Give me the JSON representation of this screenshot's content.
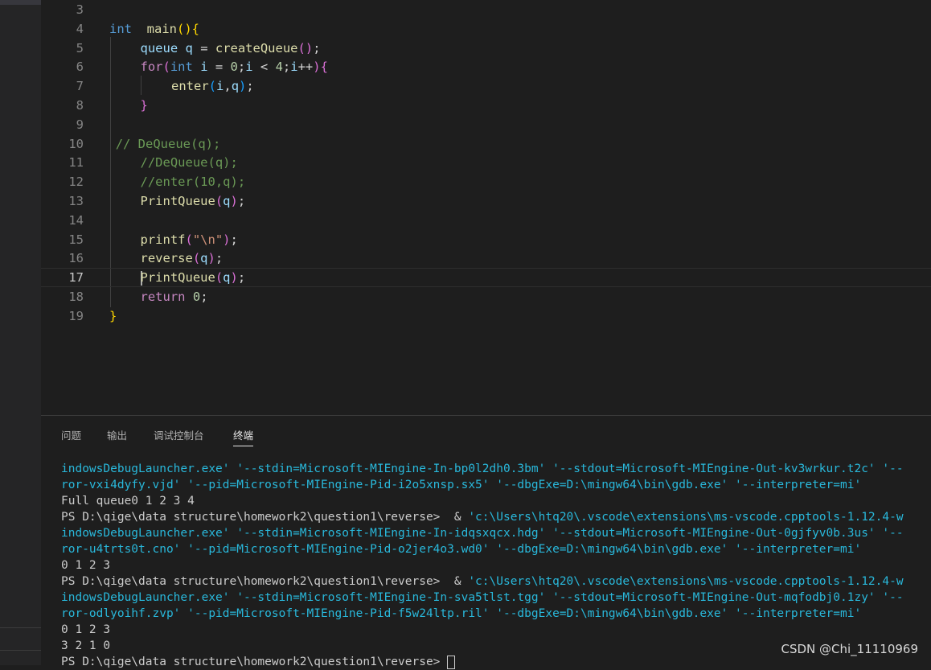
{
  "editor": {
    "lines": [
      {
        "n": "3"
      },
      {
        "n": "4",
        "parts": [
          [
            "kw",
            "int"
          ],
          [
            "",
            "  "
          ],
          [
            "fn",
            "main"
          ],
          [
            "br1",
            "()"
          ],
          [
            "br1",
            "{"
          ]
        ]
      },
      {
        "n": "5",
        "parts": [
          [
            "var",
            "queue"
          ],
          [
            "",
            " "
          ],
          [
            "var",
            "q"
          ],
          [
            "",
            " = "
          ],
          [
            "fn",
            "createQueue"
          ],
          [
            "br2",
            "()"
          ],
          [
            "",
            ";"
          ]
        ]
      },
      {
        "n": "6",
        "parts": [
          [
            "ctl",
            "for"
          ],
          [
            "br2",
            "("
          ],
          [
            "kw",
            "int"
          ],
          [
            "",
            " "
          ],
          [
            "var",
            "i"
          ],
          [
            "",
            " = "
          ],
          [
            "num",
            "0"
          ],
          [
            "",
            ";"
          ],
          [
            "var",
            "i"
          ],
          [
            "",
            " < "
          ],
          [
            "num",
            "4"
          ],
          [
            "",
            ";"
          ],
          [
            "var",
            "i"
          ],
          [
            "",
            "++"
          ],
          [
            "br2",
            ")"
          ],
          [
            "br2",
            "{"
          ]
        ]
      },
      {
        "n": "7",
        "parts": [
          [
            "fn",
            "enter"
          ],
          [
            "br3",
            "("
          ],
          [
            "var",
            "i"
          ],
          [
            "",
            ","
          ],
          [
            "var",
            "q"
          ],
          [
            "br3",
            ")"
          ],
          [
            "",
            ";"
          ]
        ]
      },
      {
        "n": "8",
        "parts": [
          [
            "br2",
            "}"
          ]
        ]
      },
      {
        "n": "9"
      },
      {
        "n": "10",
        "parts": [
          [
            "cmt",
            "// DeQueue(q);"
          ]
        ]
      },
      {
        "n": "11",
        "parts": [
          [
            "cmt",
            "//DeQueue(q);"
          ]
        ]
      },
      {
        "n": "12",
        "parts": [
          [
            "cmt",
            "//enter(10,q);"
          ]
        ]
      },
      {
        "n": "13",
        "parts": [
          [
            "fn",
            "PrintQueue"
          ],
          [
            "br2",
            "("
          ],
          [
            "var",
            "q"
          ],
          [
            "br2",
            ")"
          ],
          [
            "",
            ";"
          ]
        ]
      },
      {
        "n": "14"
      },
      {
        "n": "15",
        "parts": [
          [
            "fn",
            "printf"
          ],
          [
            "br2",
            "("
          ],
          [
            "str",
            "\"\\n\""
          ],
          [
            "br2",
            ")"
          ],
          [
            "",
            ";"
          ]
        ]
      },
      {
        "n": "16",
        "parts": [
          [
            "fn",
            "reverse"
          ],
          [
            "br2",
            "("
          ],
          [
            "var",
            "q"
          ],
          [
            "br2",
            ")"
          ],
          [
            "",
            ";"
          ]
        ]
      },
      {
        "n": "17",
        "parts": [
          [
            "fn",
            "PrintQueue"
          ],
          [
            "br2",
            "("
          ],
          [
            "var",
            "q"
          ],
          [
            "br2",
            ")"
          ],
          [
            "",
            ";"
          ]
        ]
      },
      {
        "n": "18",
        "parts": [
          [
            "ctl",
            "return"
          ],
          [
            "",
            " "
          ],
          [
            "num",
            "0"
          ],
          [
            "",
            ";"
          ]
        ]
      },
      {
        "n": "19",
        "parts": [
          [
            "br1",
            "}"
          ]
        ]
      }
    ]
  },
  "panel": {
    "tabs": [
      "问题",
      "输出",
      "调试控制台",
      "终端"
    ],
    "terminal": [
      [
        [
          "cy",
          "indowsDebugLauncher.exe' '--stdin=Microsoft-MIEngine-In-bp0l2dh0.3bm' '--stdout=Microsoft-MIEngine-Out-kv3wrkur.t2c' '--"
        ]
      ],
      [
        [
          "cy",
          "ror-vxi4dyfy.vjd' '--pid=Microsoft-MIEngine-Pid-i2o5xnsp.sx5' '--dbgExe=D:\\mingw64\\bin\\gdb.exe' '--interpreter=mi'"
        ]
      ],
      [
        [
          "",
          "Full queue0 1 2 3 4"
        ]
      ],
      [
        [
          "",
          "PS D:\\qige\\data structure\\homework2\\question1\\reverse>  & "
        ],
        [
          "cy",
          "'c:\\Users\\htq20\\.vscode\\extensions\\ms-vscode.cpptools-1.12.4-w"
        ]
      ],
      [
        [
          "cy",
          "indowsDebugLauncher.exe' '--stdin=Microsoft-MIEngine-In-idqsxqcx.hdg' '--stdout=Microsoft-MIEngine-Out-0gjfyv0b.3us' '--"
        ]
      ],
      [
        [
          "cy",
          "ror-u4trts0t.cno' '--pid=Microsoft-MIEngine-Pid-o2jer4o3.wd0' '--dbgExe=D:\\mingw64\\bin\\gdb.exe' '--interpreter=mi'"
        ]
      ],
      [
        [
          "",
          "0 1 2 3"
        ]
      ],
      [
        [
          "",
          "PS D:\\qige\\data structure\\homework2\\question1\\reverse>  & "
        ],
        [
          "cy",
          "'c:\\Users\\htq20\\.vscode\\extensions\\ms-vscode.cpptools-1.12.4-w"
        ]
      ],
      [
        [
          "cy",
          "indowsDebugLauncher.exe' '--stdin=Microsoft-MIEngine-In-sva5tlst.tgg' '--stdout=Microsoft-MIEngine-Out-mqfodbj0.1zy' '--"
        ]
      ],
      [
        [
          "cy",
          "ror-odlyoihf.zvp' '--pid=Microsoft-MIEngine-Pid-f5w24ltp.ril' '--dbgExe=D:\\mingw64\\bin\\gdb.exe' '--interpreter=mi'"
        ]
      ],
      [
        [
          "",
          "0 1 2 3"
        ]
      ],
      [
        [
          "",
          "3 2 1 0"
        ]
      ],
      [
        [
          "",
          "PS D:\\qige\\data structure\\homework2\\question1\\reverse> "
        ]
      ]
    ]
  },
  "watermark": "CSDN @Chi_11110969"
}
